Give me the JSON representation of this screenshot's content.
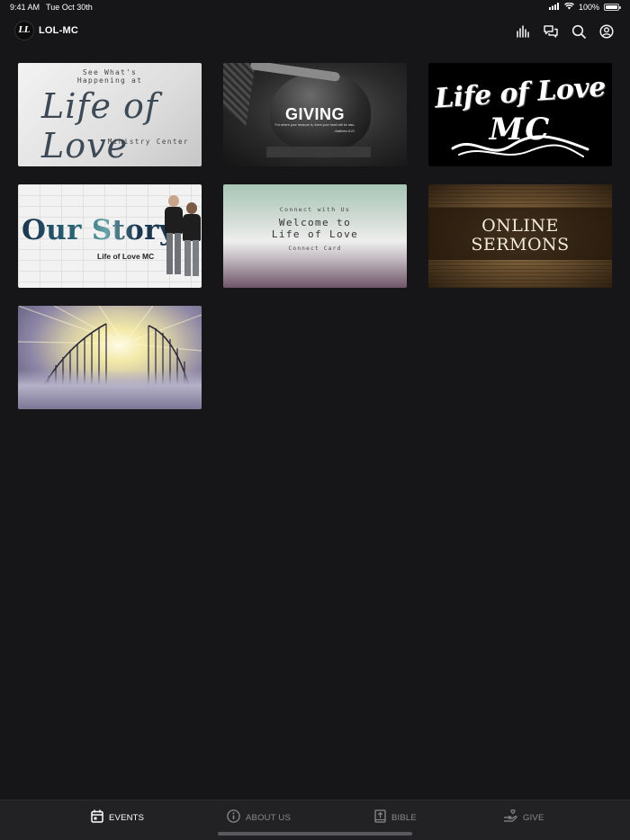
{
  "status_bar": {
    "time": "9:41 AM",
    "date": "Tue Oct 30th",
    "battery": "100%",
    "battery_level": 1.0
  },
  "header": {
    "title": "LOL-MC",
    "logo_text": "LL"
  },
  "tiles": [
    {
      "line1": "See What's",
      "line2": "Happening at",
      "script": "Life of Love",
      "tagline": "Ministry Center"
    },
    {
      "title": "GIVING",
      "verse": "For where your treasure is, there your heart will be also.",
      "reference": "- Matthew 6:21"
    },
    {
      "script": "Life of Love",
      "mark": "MC"
    },
    {
      "title": "Our Story",
      "subtitle": "Life of Love MC"
    },
    {
      "kicker": "Connect with Us",
      "title_line1": "Welcome to",
      "title_line2": "Life of Love",
      "footer": "Connect Card"
    },
    {
      "title_line1": "ONLINE",
      "title_line2": "SERMONS"
    },
    {
      "image": "heaven-gates"
    }
  ],
  "tabs": [
    {
      "label": "EVENTS",
      "active": true
    },
    {
      "label": "ABOUT US",
      "active": false
    },
    {
      "label": "BIBLE",
      "active": false
    },
    {
      "label": "GIVE",
      "active": false
    }
  ]
}
